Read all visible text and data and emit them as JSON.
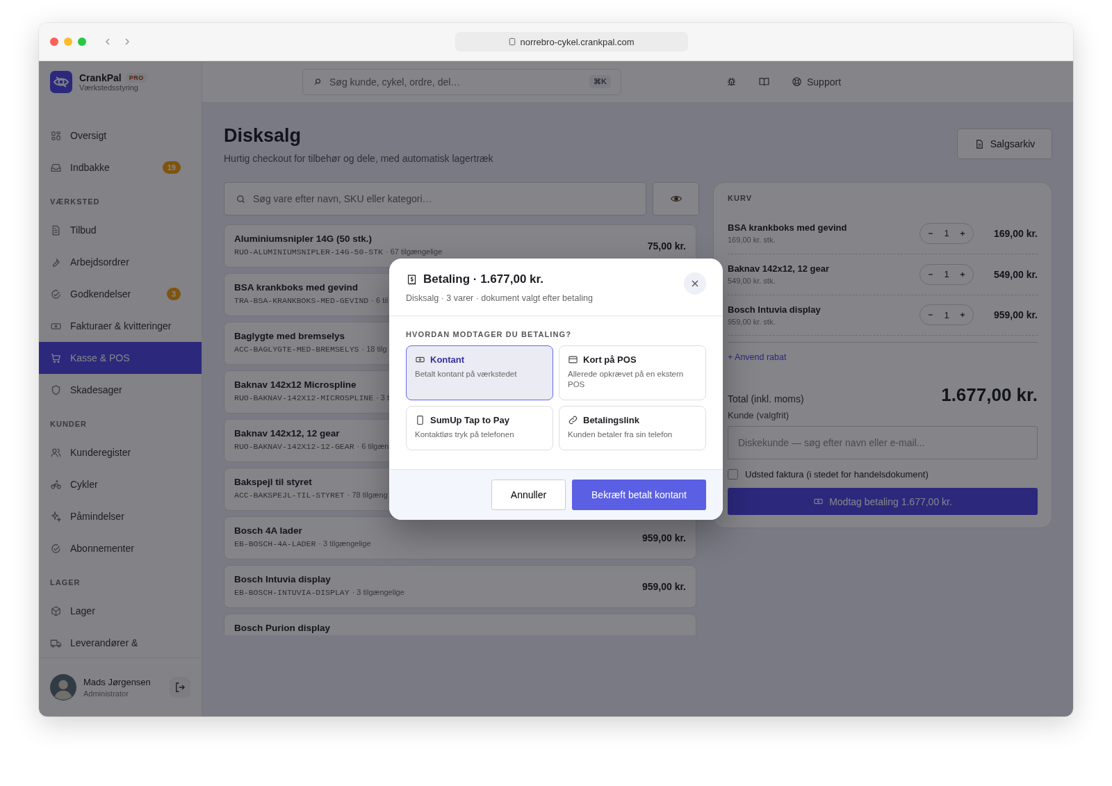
{
  "browser": {
    "url": "norrebro-cykel.crankpal.com"
  },
  "brand": {
    "name": "CrankPal",
    "badge": "PRO",
    "subtitle": "Værkstedsstyring"
  },
  "sidebar": {
    "items": [
      {
        "kind": "item",
        "label": "Oversigt",
        "selected": false
      },
      {
        "kind": "item",
        "label": "Indbakke",
        "badge": "19",
        "selected": false
      },
      {
        "kind": "heading",
        "label": "VÆRKSTED"
      },
      {
        "kind": "item",
        "label": "Tilbud",
        "selected": false
      },
      {
        "kind": "item",
        "label": "Arbejdsordrer",
        "selected": false
      },
      {
        "kind": "item",
        "label": "Godkendelser",
        "badge": "3",
        "selected": false
      },
      {
        "kind": "item",
        "label": "Fakturaer & kvitteringer",
        "selected": false
      },
      {
        "kind": "item",
        "label": "Kasse & POS",
        "selected": true
      },
      {
        "kind": "item",
        "label": "Skadesager",
        "selected": false
      },
      {
        "kind": "heading",
        "label": "KUNDER"
      },
      {
        "kind": "item",
        "label": "Kunderegister",
        "selected": false
      },
      {
        "kind": "item",
        "label": "Cykler",
        "selected": false
      },
      {
        "kind": "item",
        "label": "Påmindelser",
        "selected": false
      },
      {
        "kind": "item",
        "label": "Abonnementer",
        "selected": false
      },
      {
        "kind": "heading",
        "label": "LAGER"
      },
      {
        "kind": "item",
        "label": "Lager",
        "selected": false
      },
      {
        "kind": "item",
        "label": "Leverandører &",
        "selected": false
      }
    ]
  },
  "user": {
    "name": "Mads Jørgensen",
    "role": "Administrator"
  },
  "header": {
    "search_placeholder": "Søg kunde, cykel, ordre, del…",
    "shortcut": "⌘K",
    "support": "Support"
  },
  "page": {
    "title": "Disksalg",
    "subtitle": "Hurtig checkout for tilbehør og dele, med automatisk lagertræk",
    "archive_button": "Salgsarkiv",
    "search_placeholder": "Søg vare efter navn, SKU eller kategori…"
  },
  "products": [
    {
      "name": "Aluminiumsnipler 14G (50 stk.)",
      "sku": "RUO-ALUMINIUMSNIPLER-14G-50-STK",
      "stock": "· 67 tilgængelige",
      "price": "75,00 kr."
    },
    {
      "name": "BSA krankboks med gevind",
      "sku": "TRA-BSA-KRANKBOKS-MED-GEVIND",
      "stock": "· 6 til"
    },
    {
      "name": "Baglygte med bremselys",
      "sku": "ACC-BAGLYGTE-MED-BREMSELYS",
      "stock": "· 18 tilg"
    },
    {
      "name": "Baknav 142x12 Microspline",
      "sku": "RUO-BAKNAV-142X12-MICROSPLINE",
      "stock": "· 3 t"
    },
    {
      "name": "Baknav 142x12, 12 gear",
      "sku": "RUO-BAKNAV-142X12-12-GEAR",
      "stock": "· 6 tilgæn"
    },
    {
      "name": "Bakspejl til styret",
      "sku": "ACC-BAKSPEJL-TIL-STYRET",
      "stock": "· 78 tilgæng"
    },
    {
      "name": "Bosch 4A lader",
      "sku": "EB-BOSCH-4A-LADER",
      "stock": "· 3 tilgængelige",
      "price": "959,00 kr."
    },
    {
      "name": "Bosch Intuvia display",
      "sku": "EB-BOSCH-INTUVIA-DISPLAY",
      "stock": "· 3 tilgængelige",
      "price": "959,00 kr."
    },
    {
      "name": "Bosch Purion display"
    }
  ],
  "cart": {
    "title": "KURV",
    "items": [
      {
        "name": "BSA krankboks med gevind",
        "unit": "169,00 kr. stk.",
        "qty": "1",
        "total": "169,00 kr."
      },
      {
        "name": "Baknav 142x12, 12 gear",
        "unit": "549,00 kr. stk.",
        "qty": "1",
        "total": "549,00 kr."
      },
      {
        "name": "Bosch Intuvia display",
        "unit": "959,00 kr. stk.",
        "qty": "1",
        "total": "959,00 kr."
      }
    ],
    "discount": "+ Anvend rabat",
    "total_label": "Total (inkl. moms)",
    "total": "1.677,00 kr.",
    "customer_label": "Kunde (valgfrit)",
    "customer_placeholder": "Diskekunde — søg efter navn eller e-mail...",
    "invoice": {
      "label": "Udsted faktura (i stedet for handelsdokument)",
      "checked": false
    },
    "pay_button": "Modtag betaling 1.677,00 kr."
  },
  "modal": {
    "title": "Betaling · 1.677,00 kr.",
    "subtitle": "Disksalg · 3 varer · dokument valgt efter betaling",
    "question": "HVORDAN MODTAGER DU BETALING?",
    "options": [
      {
        "title": "Kontant",
        "description": "Betalt kontant på værkstedet",
        "selected": true
      },
      {
        "title": "Kort på POS",
        "description": "Allerede opkrævet på en ekstern POS",
        "selected": false
      },
      {
        "title": "SumUp Tap to Pay",
        "description": "Kontaktløs tryk på telefonen",
        "selected": false
      },
      {
        "title": "Betalingslink",
        "description": "Kunden betaler fra sin telefon",
        "selected": false
      }
    ],
    "cancel": "Annuller",
    "confirm": "Bekræft betalt kontant"
  }
}
